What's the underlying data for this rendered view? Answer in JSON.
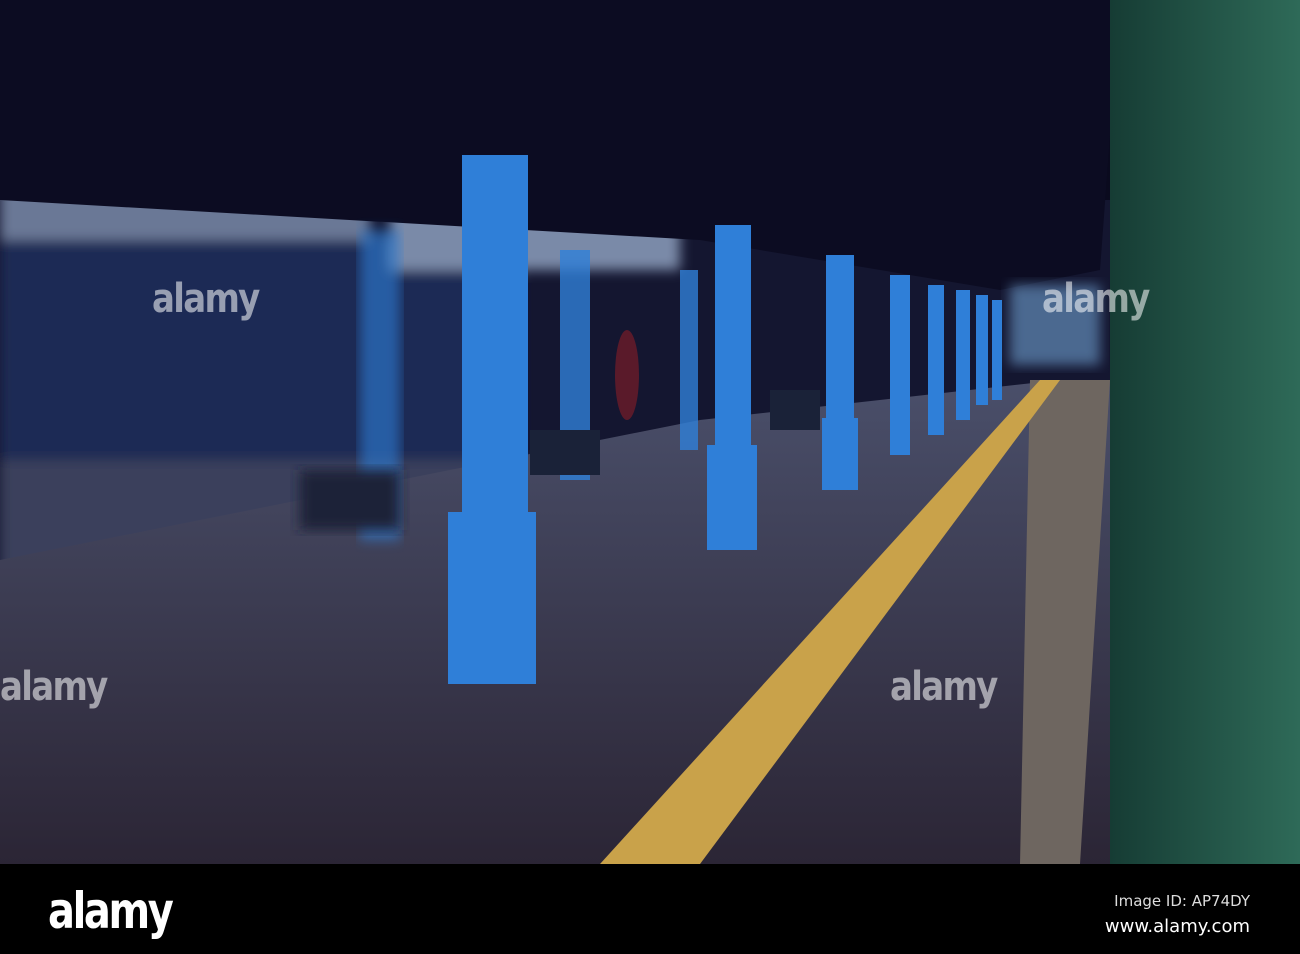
{
  "watermark": "alamy",
  "footer": {
    "logo": "alamy",
    "image_id": "Image ID: AP74DY",
    "website": "www.alamy.com"
  },
  "colors": {
    "pillar": "#2f7fd8",
    "tactile_strip": "#c9a24a",
    "wall": "#1f5a4a",
    "roof": "#0a0a1e"
  }
}
